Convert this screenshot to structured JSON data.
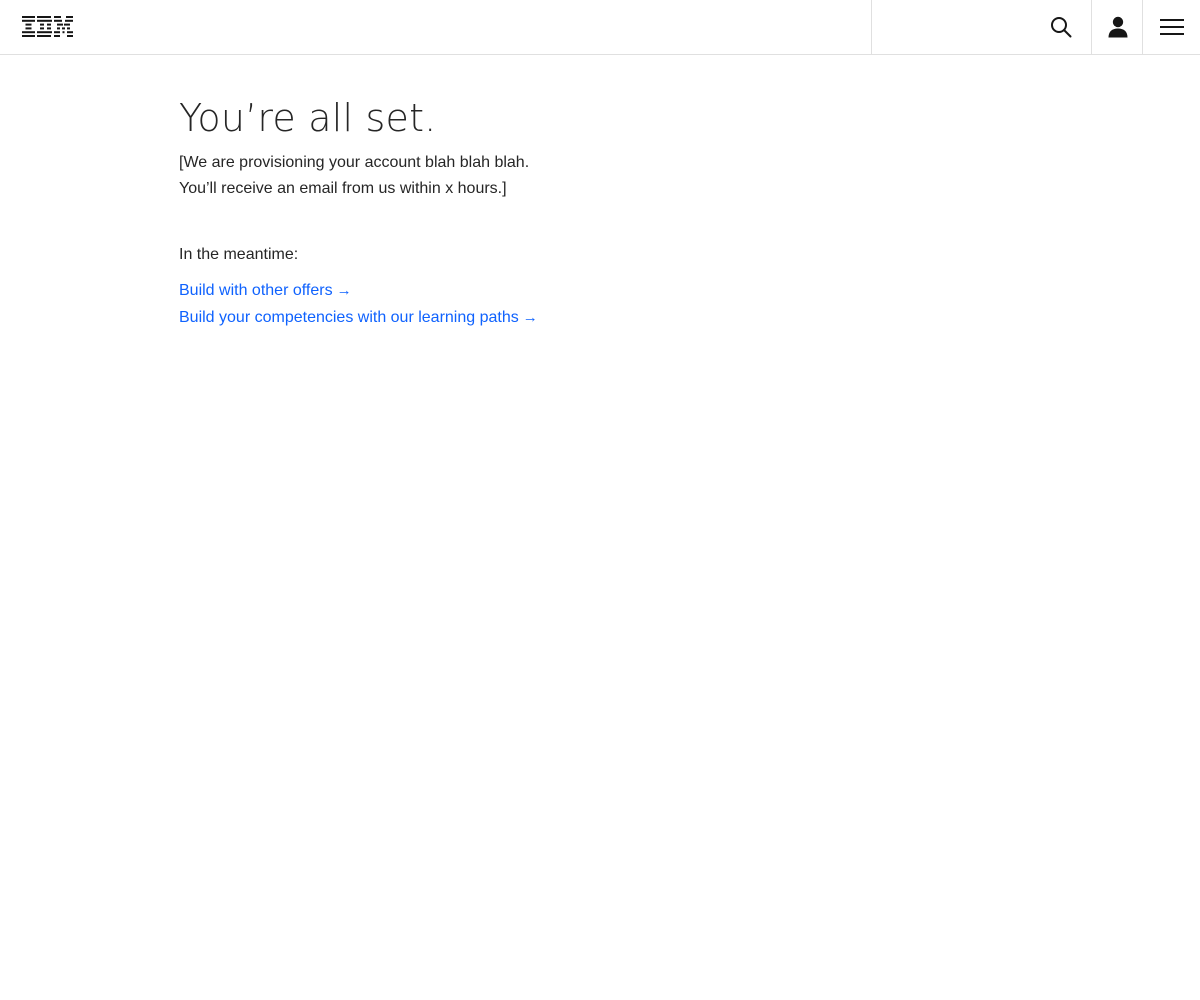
{
  "header": {
    "logo_alt": "IBM",
    "search_icon": "search-icon",
    "user_icon": "user-icon",
    "menu_icon": "menu-icon"
  },
  "main": {
    "title": "You’re all set.",
    "description_line1": "[We are provisioning your account blah blah blah.",
    "description_line2": "You’ll receive an email from us within x hours.]",
    "meantime_label": "In the meantime:",
    "links": [
      {
        "label": "Build with other offers",
        "arrow": "→"
      },
      {
        "label": "Build your competencies with our learning paths",
        "arrow": "→"
      }
    ]
  },
  "colors": {
    "link": "#0f62fe",
    "text": "#262626",
    "border": "#e0e0e0"
  }
}
